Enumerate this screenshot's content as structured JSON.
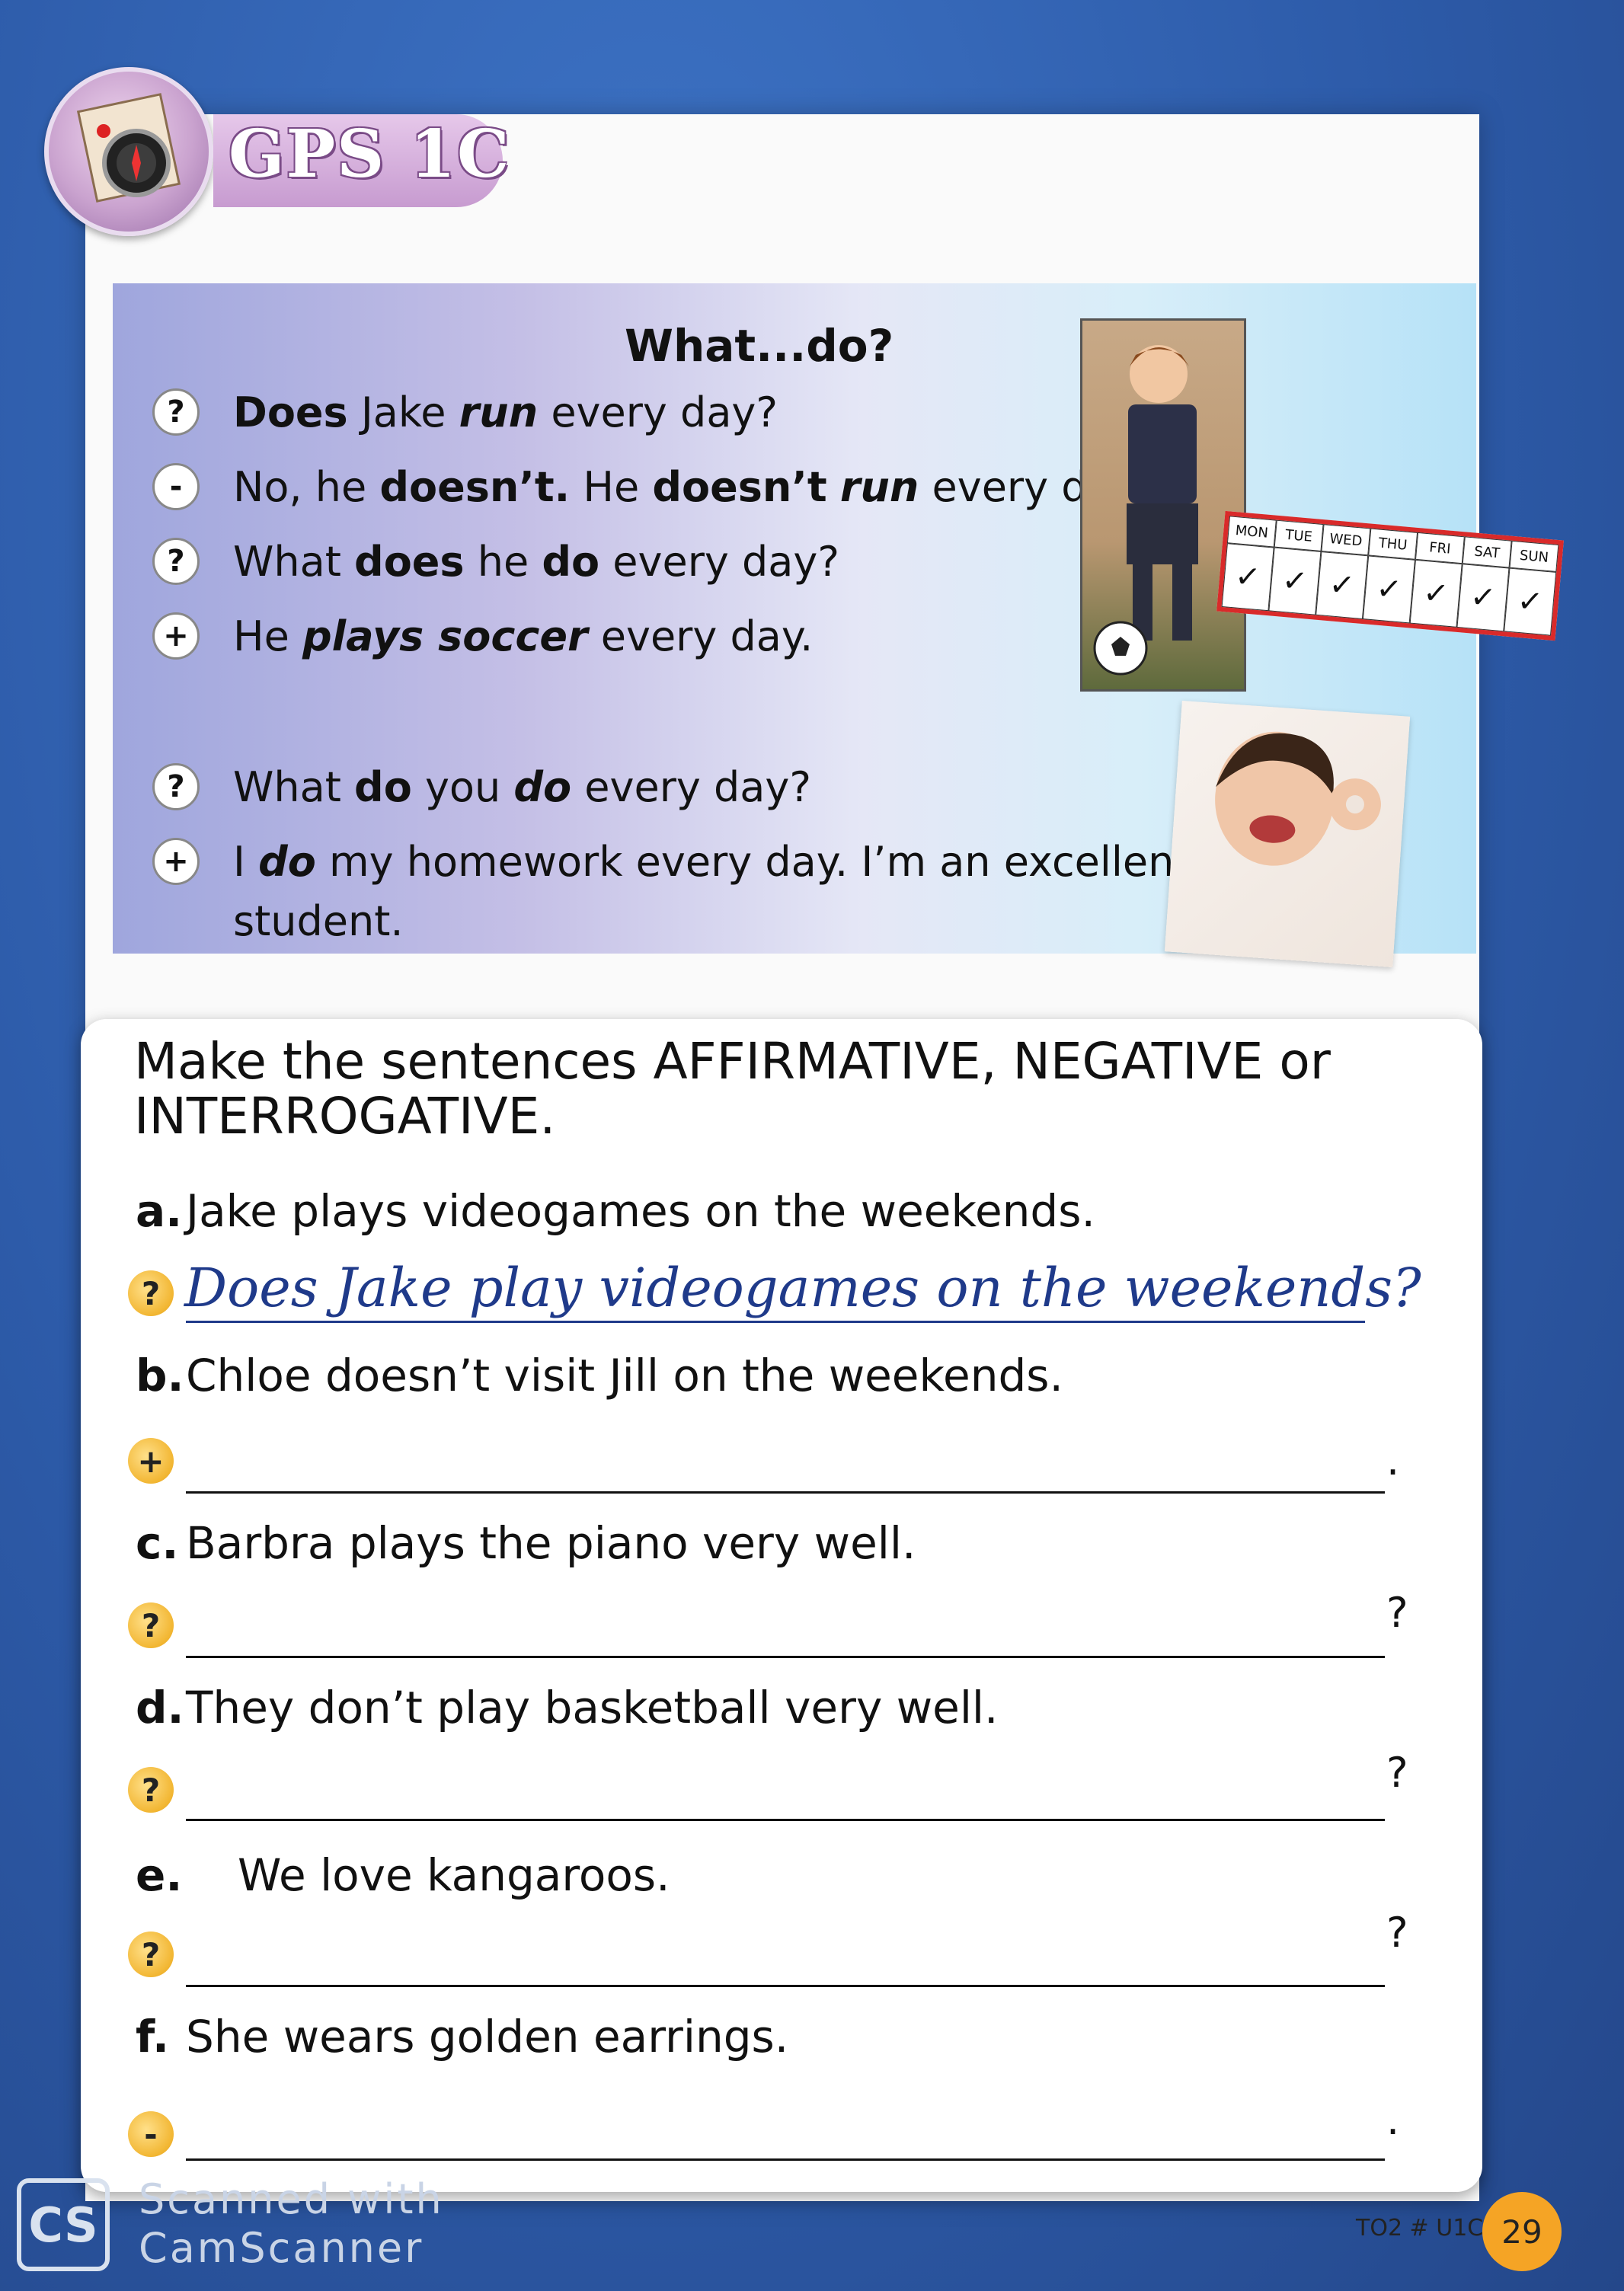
{
  "header": {
    "title": "GPS 1C"
  },
  "grammar": {
    "title": "What...do?",
    "lines": [
      {
        "sym": "?",
        "parts": [
          [
            "b",
            "Does"
          ],
          [
            "n",
            " Jake "
          ],
          [
            "i",
            "run"
          ],
          [
            "n",
            " every day?"
          ]
        ]
      },
      {
        "sym": "-",
        "parts": [
          [
            "n",
            "No, he "
          ],
          [
            "b",
            "doesn’t."
          ],
          [
            "n",
            " He "
          ],
          [
            "b",
            "doesn’t"
          ],
          [
            "n",
            " "
          ],
          [
            "i",
            "run"
          ],
          [
            "n",
            " every day."
          ]
        ]
      },
      {
        "sym": "?",
        "parts": [
          [
            "n",
            "What "
          ],
          [
            "b",
            "does"
          ],
          [
            "n",
            " he "
          ],
          [
            "b",
            "do"
          ],
          [
            "n",
            " every day?"
          ]
        ]
      },
      {
        "sym": "+",
        "parts": [
          [
            "n",
            "He "
          ],
          [
            "i",
            "plays soccer"
          ],
          [
            "n",
            " every day."
          ]
        ]
      },
      {
        "sym": "?",
        "parts": [
          [
            "n",
            "What "
          ],
          [
            "b",
            "do"
          ],
          [
            "n",
            " you "
          ],
          [
            "i",
            "do"
          ],
          [
            "n",
            " every day?"
          ]
        ]
      },
      {
        "sym": "+",
        "parts": [
          [
            "n",
            "I "
          ],
          [
            "i",
            "do"
          ],
          [
            "n",
            " my homework every day. I’m an excellent"
          ]
        ]
      }
    ],
    "line6_cont": "student."
  },
  "schedule": {
    "days": [
      "MON",
      "TUE",
      "WED",
      "THU",
      "FRI",
      "SAT",
      "SUN"
    ],
    "check": "✓"
  },
  "exercise": {
    "instruction": "Make the sentences AFFIRMATIVE, NEGATIVE or INTERROGATIVE.",
    "items": [
      {
        "label": "a.",
        "text": "Jake plays videogames on the weekends.",
        "sym": "?",
        "answer": "Does Jake play videogames on the weekends?",
        "end": ""
      },
      {
        "label": "b.",
        "text": "Chloe doesn’t visit Jill on the weekends.",
        "sym": "+",
        "answer": "",
        "end": "."
      },
      {
        "label": "c.",
        "text": "Barbra plays the piano very well.",
        "sym": "?",
        "answer": "",
        "end": "?"
      },
      {
        "label": "d.",
        "text": "They don’t play basketball very well.",
        "sym": "?",
        "answer": "",
        "end": "?"
      },
      {
        "label": "e.",
        "text": "We love kangaroos.",
        "sym": "?",
        "answer": "",
        "end": "?"
      },
      {
        "label": "f.",
        "text": "She wears golden earrings.",
        "sym": "-",
        "answer": "",
        "end": "."
      }
    ]
  },
  "footer": {
    "code": "TO2 # U1C",
    "page": "29"
  },
  "watermark": {
    "logo": "CS",
    "line1": "Scanned with",
    "line2": "CamScanner"
  }
}
